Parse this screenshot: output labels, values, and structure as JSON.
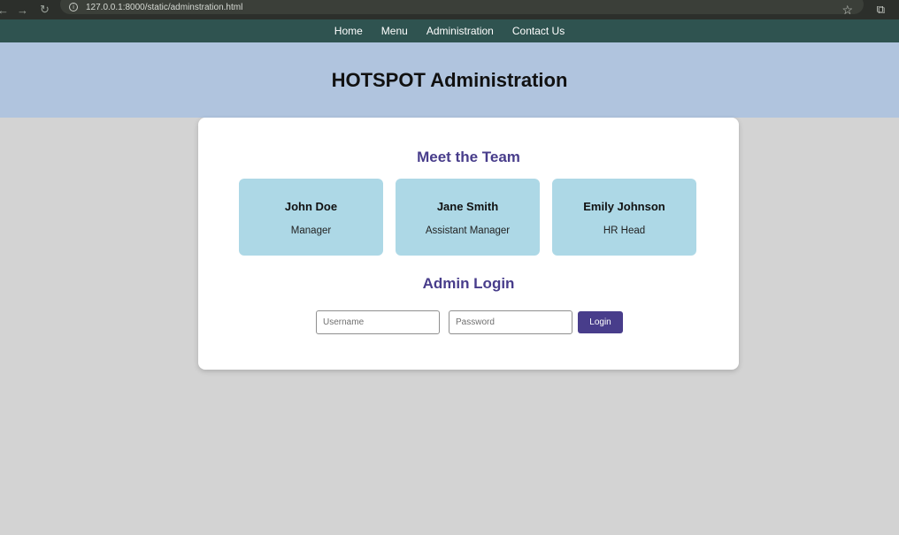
{
  "browser": {
    "url": "127.0.0.1:8000/static/adminstration.html"
  },
  "nav": {
    "items": [
      {
        "label": "Home"
      },
      {
        "label": "Menu"
      },
      {
        "label": "Administration"
      },
      {
        "label": "Contact Us"
      }
    ]
  },
  "hero": {
    "title": "HOTSPOT Administration"
  },
  "team": {
    "title": "Meet the Team",
    "members": [
      {
        "name": "John Doe",
        "role": "Manager"
      },
      {
        "name": "Jane Smith",
        "role": "Assistant Manager"
      },
      {
        "name": "Emily Johnson",
        "role": "HR Head"
      }
    ]
  },
  "login": {
    "title": "Admin Login",
    "username_placeholder": "Username",
    "username_value": "",
    "password_placeholder": "Password",
    "password_value": "",
    "button_label": "Login"
  },
  "colors": {
    "nav_bg": "#2f5350",
    "hero_bg": "#b0c4de",
    "page_bg": "#d3d3d3",
    "accent": "#483d8b",
    "member_card_bg": "#add8e6"
  }
}
